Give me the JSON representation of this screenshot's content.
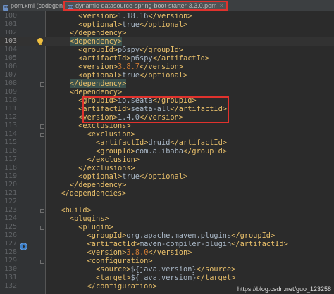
{
  "tabs": [
    {
      "label": "pom.xml (codegen)",
      "active": false
    },
    {
      "label": "dynamic-datasource-spring-boot-starter-3.3.0.pom",
      "active": true
    }
  ],
  "watermark": "https://blog.csdn.net/guo_123258",
  "current_line": 103,
  "lines": [
    {
      "n": "100",
      "indent": 6,
      "segs": [
        [
          "t",
          "<version>"
        ],
        [
          "v",
          "1.18.16"
        ],
        [
          "t",
          "</version>"
        ]
      ]
    },
    {
      "n": "101",
      "indent": 6,
      "segs": [
        [
          "t",
          "<optional>"
        ],
        [
          "v",
          "true"
        ],
        [
          "t",
          "</optional>"
        ]
      ]
    },
    {
      "n": "102",
      "indent": 4,
      "segs": [
        [
          "t",
          "</dependency>"
        ]
      ]
    },
    {
      "n": "103",
      "indent": 4,
      "segs": [
        [
          "th",
          "<dependency>"
        ]
      ]
    },
    {
      "n": "104",
      "indent": 6,
      "segs": [
        [
          "t",
          "<groupId>"
        ],
        [
          "v",
          "p6spy"
        ],
        [
          "t",
          "</groupId>"
        ]
      ]
    },
    {
      "n": "105",
      "indent": 6,
      "segs": [
        [
          "t",
          "<artifactId>"
        ],
        [
          "v",
          "p6spy"
        ],
        [
          "t",
          "</artifactId>"
        ]
      ]
    },
    {
      "n": "106",
      "indent": 6,
      "segs": [
        [
          "t",
          "<version>"
        ],
        [
          "o",
          "3.8.7"
        ],
        [
          "t",
          "</version>"
        ]
      ]
    },
    {
      "n": "107",
      "indent": 6,
      "segs": [
        [
          "t",
          "<optional>"
        ],
        [
          "v",
          "true"
        ],
        [
          "t",
          "</optional>"
        ]
      ]
    },
    {
      "n": "108",
      "indent": 4,
      "segs": [
        [
          "th",
          "</dependency>"
        ]
      ]
    },
    {
      "n": "109",
      "indent": 4,
      "segs": [
        [
          "t",
          "<dependency>"
        ]
      ]
    },
    {
      "n": "110",
      "indent": 6,
      "segs": [
        [
          "t",
          "<groupId>"
        ],
        [
          "v",
          "io.seata"
        ],
        [
          "t",
          "</groupId>"
        ]
      ]
    },
    {
      "n": "111",
      "indent": 6,
      "segs": [
        [
          "t",
          "<artifactId>"
        ],
        [
          "v",
          "seata-all"
        ],
        [
          "t",
          "</artifactId>"
        ]
      ]
    },
    {
      "n": "112",
      "indent": 6,
      "segs": [
        [
          "t",
          "<version>"
        ],
        [
          "v",
          "1.4.0"
        ],
        [
          "t",
          "</version>"
        ]
      ]
    },
    {
      "n": "113",
      "indent": 6,
      "segs": [
        [
          "t",
          "<exclusions>"
        ]
      ]
    },
    {
      "n": "114",
      "indent": 8,
      "segs": [
        [
          "t",
          "<exclusion>"
        ]
      ]
    },
    {
      "n": "115",
      "indent": 10,
      "segs": [
        [
          "t",
          "<artifactId>"
        ],
        [
          "v",
          "druid"
        ],
        [
          "t",
          "</artifactId>"
        ]
      ]
    },
    {
      "n": "116",
      "indent": 10,
      "segs": [
        [
          "t",
          "<groupId>"
        ],
        [
          "v",
          "com.alibaba"
        ],
        [
          "t",
          "</groupId>"
        ]
      ]
    },
    {
      "n": "117",
      "indent": 8,
      "segs": [
        [
          "t",
          "</exclusion>"
        ]
      ]
    },
    {
      "n": "118",
      "indent": 6,
      "segs": [
        [
          "t",
          "</exclusions>"
        ]
      ]
    },
    {
      "n": "119",
      "indent": 6,
      "segs": [
        [
          "t",
          "<optional>"
        ],
        [
          "v",
          "true"
        ],
        [
          "t",
          "</optional>"
        ]
      ]
    },
    {
      "n": "120",
      "indent": 4,
      "segs": [
        [
          "t",
          "</dependency>"
        ]
      ]
    },
    {
      "n": "121",
      "indent": 2,
      "segs": [
        [
          "t",
          "</dependencies>"
        ]
      ]
    },
    {
      "n": "122",
      "indent": 0,
      "segs": []
    },
    {
      "n": "123",
      "indent": 2,
      "segs": [
        [
          "t",
          "<build>"
        ]
      ]
    },
    {
      "n": "124",
      "indent": 4,
      "segs": [
        [
          "t",
          "<plugins>"
        ]
      ]
    },
    {
      "n": "125",
      "indent": 6,
      "segs": [
        [
          "t",
          "<plugin>"
        ]
      ]
    },
    {
      "n": "126",
      "indent": 8,
      "segs": [
        [
          "t",
          "<groupId>"
        ],
        [
          "v",
          "org.apache.maven.plugins"
        ],
        [
          "t",
          "</groupId>"
        ]
      ]
    },
    {
      "n": "127",
      "indent": 8,
      "segs": [
        [
          "t",
          "<artifactId>"
        ],
        [
          "v",
          "maven-compiler-plugin"
        ],
        [
          "t",
          "</artifactId>"
        ]
      ]
    },
    {
      "n": "128",
      "indent": 8,
      "segs": [
        [
          "t",
          "<version>"
        ],
        [
          "o",
          "3.8.0"
        ],
        [
          "t",
          "</version>"
        ]
      ]
    },
    {
      "n": "129",
      "indent": 8,
      "segs": [
        [
          "t",
          "<configuration>"
        ]
      ]
    },
    {
      "n": "130",
      "indent": 10,
      "segs": [
        [
          "t",
          "<source>"
        ],
        [
          "v",
          "${java.version}"
        ],
        [
          "t",
          "</source>"
        ]
      ]
    },
    {
      "n": "131",
      "indent": 10,
      "segs": [
        [
          "t",
          "<target>"
        ],
        [
          "v",
          "${java.version}"
        ],
        [
          "t",
          "</target>"
        ]
      ]
    },
    {
      "n": "132",
      "indent": 8,
      "segs": [
        [
          "t",
          "</configuration>"
        ]
      ]
    }
  ],
  "colors": {
    "background": "#2b2b2b",
    "tag": "#e8bf6a",
    "text": "#a9b7c6",
    "version_number": "#cc7832",
    "tag_highlight": "#3b514d",
    "annotation_box": "#e0322d"
  }
}
